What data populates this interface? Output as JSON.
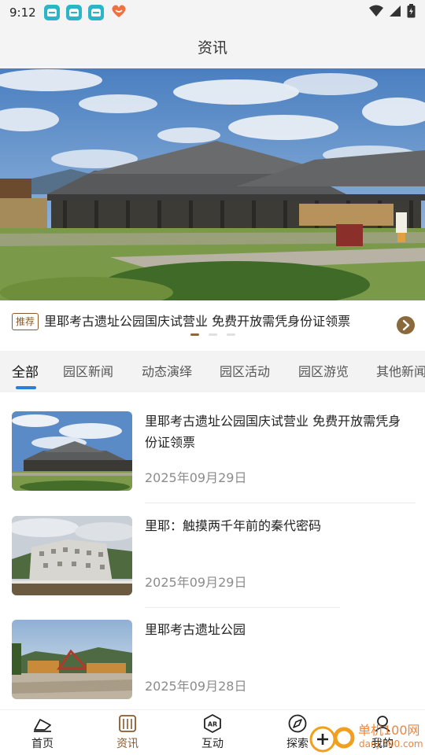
{
  "status_bar": {
    "time": "9:12"
  },
  "header": {
    "title": "资讯"
  },
  "banner": {
    "tag": "推荐",
    "headline": "里耶考古遗址公园国庆试营业 免费开放需凭身份证领票",
    "dot_count": 3,
    "active_dot": 0
  },
  "tabs": [
    {
      "label": "全部",
      "active": true
    },
    {
      "label": "园区新闻",
      "active": false
    },
    {
      "label": "动态演绎",
      "active": false
    },
    {
      "label": "园区活动",
      "active": false
    },
    {
      "label": "园区游览",
      "active": false
    },
    {
      "label": "其他新闻",
      "active": false
    }
  ],
  "news": [
    {
      "title": "里耶考古遗址公园国庆试营业 免费开放需凭身份证领票",
      "date": "2025年09月29日"
    },
    {
      "title": "里耶：触摸两千年前的秦代密码",
      "date": "2025年09月29日"
    },
    {
      "title": "里耶考古遗址公园",
      "date": "2025年09月28日"
    }
  ],
  "bottom_nav": [
    {
      "label": "首页",
      "icon": "home-icon",
      "active": false
    },
    {
      "label": "资讯",
      "icon": "news-icon",
      "active": true
    },
    {
      "label": "互动",
      "icon": "ar-icon",
      "active": false
    },
    {
      "label": "探索",
      "icon": "compass-icon",
      "active": false
    },
    {
      "label": "我的",
      "icon": "profile-icon",
      "active": false
    }
  ],
  "watermark": {
    "brand": "单机100网",
    "url": "danji100.com"
  },
  "colors": {
    "accent": "#8a5a2b",
    "tab_indicator": "#2c7fd6",
    "date_gray": "#8c8c8c"
  }
}
